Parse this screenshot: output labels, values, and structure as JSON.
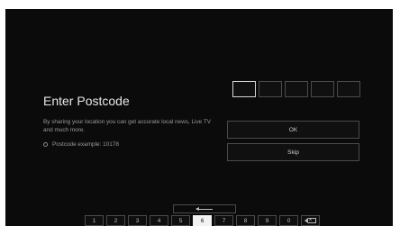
{
  "dialog": {
    "title": "Enter Postcode",
    "description": "By sharing your location you can get accurate local news, Live TV and much more.",
    "hint": "Postcode example: 10178"
  },
  "postcode": {
    "digits": [
      "",
      "",
      "",
      "",
      ""
    ],
    "active_index": 0
  },
  "buttons": {
    "ok_label": "OK",
    "skip_label": "Skip"
  },
  "keypad": {
    "keys": [
      "1",
      "2",
      "3",
      "4",
      "5",
      "6",
      "7",
      "8",
      "9",
      "0"
    ],
    "selected": "6",
    "backspace_icon": "backspace-arrow-icon",
    "delete_icon": "delete-icon"
  },
  "colors": {
    "background": "#0b0b0b",
    "text": "#e6e6e6",
    "muted": "#9a9a9a",
    "border": "#4a4a4a",
    "selected_key": "#f2f2f2"
  }
}
